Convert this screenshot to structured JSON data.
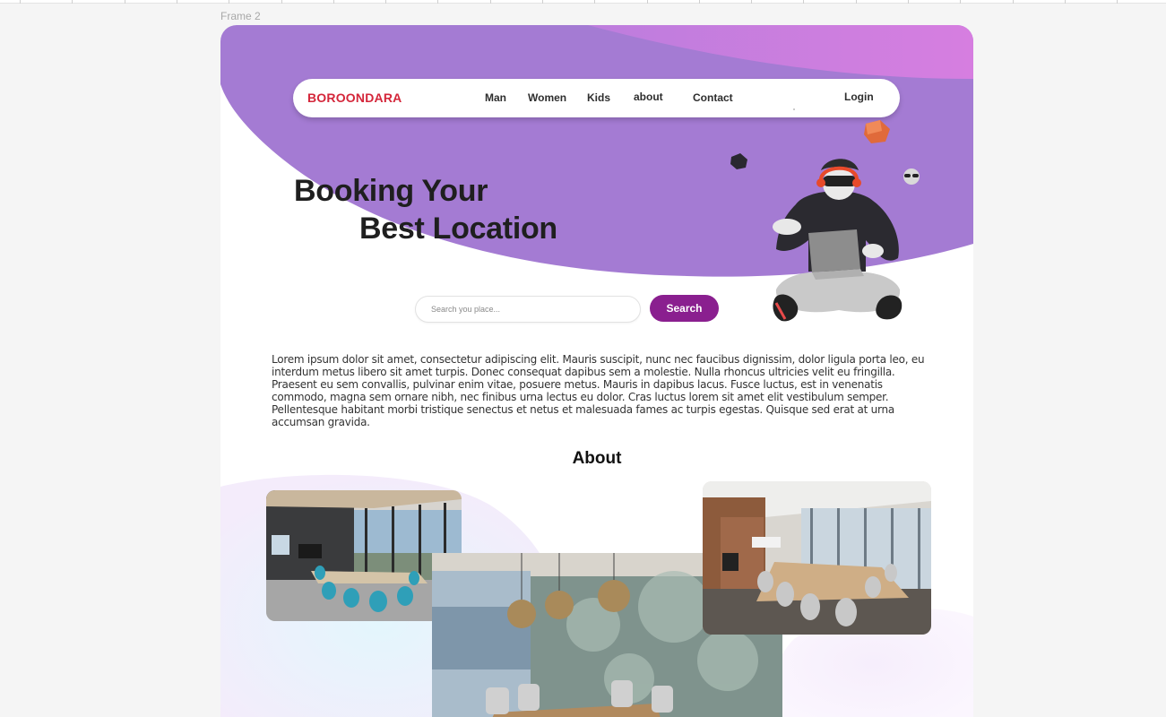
{
  "canvas": {
    "frame_label": "Frame 2"
  },
  "nav": {
    "brand": "BOROONDARA",
    "links": [
      "Man",
      "Women",
      "Kids",
      "about",
      "Contact"
    ],
    "login": "Login"
  },
  "hero": {
    "headline_line1": "Booking Your",
    "headline_line2": "Best Location"
  },
  "search": {
    "placeholder": "Search you place...",
    "value": "",
    "button_label": "Search"
  },
  "intro": {
    "paragraph": "Lorem ipsum dolor sit amet, consectetur adipiscing elit. Mauris suscipit, nunc nec faucibus dignissim, dolor ligula porta leo, eu interdum metus libero sit amet turpis. Donec consequat dapibus sem a molestie. Nulla rhoncus ultricies velit eu fringilla. Praesent eu sem convallis, pulvinar enim vitae, posuere metus. Mauris in dapibus lacus. Fusce luctus, est in venenatis commodo, magna sem ornare nibh, nec finibus urna lectus eu dolor. Cras luctus lorem sit amet elit vestibulum semper. Pellentesque habitant morbi tristique senectus et netus et malesuada fames ac turpis egestas. Quisque sed erat at urna accumsan gravida."
  },
  "about": {
    "title": "About"
  },
  "colors": {
    "hero_purple": "#a47bd3",
    "hero_pink": "#d67ee0",
    "brand_red": "#d4263a",
    "search_button": "#8a1f8f"
  },
  "icons": [
    "vr-headset-character",
    "laptop-icon",
    "floating-cube-icon",
    "sunglasses-emoji-icon"
  ]
}
